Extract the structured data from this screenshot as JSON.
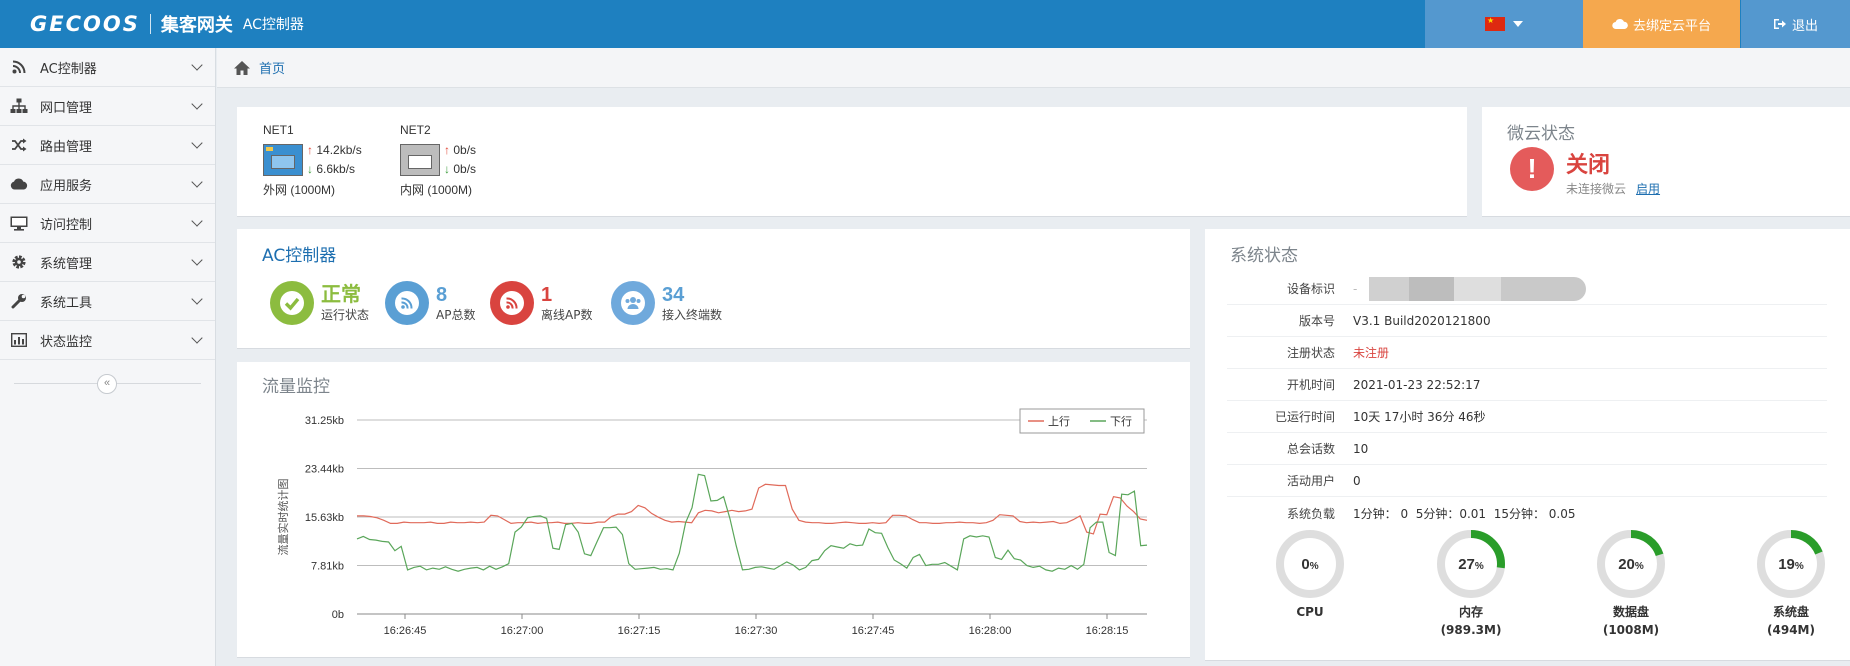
{
  "header": {
    "logo": "GECOOS",
    "brand_name": "集客网关",
    "brand_sub": "AC控制器",
    "cloud_button": "去绑定云平台",
    "logout": "退出"
  },
  "sidebar": {
    "items": [
      {
        "label": "AC控制器",
        "icon": "rss-icon"
      },
      {
        "label": "网口管理",
        "icon": "sitemap-icon"
      },
      {
        "label": "路由管理",
        "icon": "shuffle-icon"
      },
      {
        "label": "应用服务",
        "icon": "cloud-icon"
      },
      {
        "label": "访问控制",
        "icon": "monitor-icon"
      },
      {
        "label": "系统管理",
        "icon": "gear-icon"
      },
      {
        "label": "系统工具",
        "icon": "wrench-icon"
      },
      {
        "label": "状态监控",
        "icon": "bar-chart-icon"
      }
    ],
    "collapse": "«"
  },
  "breadcrumb": {
    "home": "首页"
  },
  "network": {
    "ports": [
      {
        "name": "NET1",
        "up": "14.2kb/s",
        "down": "6.6kb/s",
        "label": "外网 (1000M)",
        "active": true
      },
      {
        "name": "NET2",
        "up": "0b/s",
        "down": "0b/s",
        "label": "内网 (1000M)",
        "active": false
      }
    ]
  },
  "cloud_status": {
    "title": "微云状态",
    "state": "关闭",
    "desc": "未连接微云",
    "link": "启用"
  },
  "ac": {
    "title": "AC控制器",
    "stats": [
      {
        "value": "正常",
        "label": "运行状态",
        "color": "#8cbc3f"
      },
      {
        "value": "8",
        "label": "AP总数",
        "color": "#5a9fd4"
      },
      {
        "value": "1",
        "label": "离线AP数",
        "color": "#d9443f"
      },
      {
        "value": "34",
        "label": "接入终端数",
        "color": "#5a9fd4"
      }
    ]
  },
  "traffic": {
    "title": "流量监控"
  },
  "system": {
    "title": "系统状态",
    "rows": [
      {
        "key": "设备标识",
        "value": "-"
      },
      {
        "key": "版本号",
        "value": "V3.1 Build2020121800"
      },
      {
        "key": "注册状态",
        "value": "未注册"
      },
      {
        "key": "开机时间",
        "value": "2021-01-23 22:52:17"
      },
      {
        "key": "已运行时间",
        "value": "10天 17小时 36分 46秒"
      },
      {
        "key": "总会话数",
        "value": "10"
      },
      {
        "key": "活动用户",
        "value": "0"
      },
      {
        "key": "系统负载",
        "value": "1分钟： 0  5分钟：0.01  15分钟： 0.05"
      }
    ],
    "gauges": [
      {
        "value": 0,
        "text": "0",
        "unit": "%",
        "label": "CPU",
        "sub": ""
      },
      {
        "value": 27,
        "text": "27",
        "unit": "%",
        "label": "内存",
        "sub": "(989.3M)"
      },
      {
        "value": 20,
        "text": "20",
        "unit": "%",
        "label": "数据盘",
        "sub": "(1008M)"
      },
      {
        "value": 19,
        "text": "19",
        "unit": "%",
        "label": "系统盘",
        "sub": "(494M)"
      }
    ]
  },
  "chart_data": {
    "type": "line",
    "title": "",
    "ylabel": "流量实时统计图",
    "y_ticks": [
      "0b",
      "7.81kb",
      "15.63kb",
      "23.44kb",
      "31.25kb"
    ],
    "ylim": [
      0,
      31.25
    ],
    "x_ticks": [
      "16:26:45",
      "16:27:00",
      "16:27:15",
      "16:27:30",
      "16:27:45",
      "16:28:00",
      "16:28:15"
    ],
    "legend_position": "top-right",
    "grid": true,
    "series": [
      {
        "name": "上行",
        "color": "#e06a5a",
        "values": [
          15.8,
          15.8,
          15.7,
          15.5,
          15.1,
          14.6,
          14.6,
          14.8,
          14.7,
          14.7,
          14.7,
          14.8,
          14.6,
          14.6,
          14.8,
          14.7,
          14.7,
          14.8,
          14.7,
          14.8,
          15.9,
          15.8,
          15.2,
          14.6,
          14.7,
          14.7,
          14.8,
          14.6,
          14.7,
          14.7,
          14.8,
          14.6,
          14.6,
          14.7,
          14.6,
          14.6,
          14.8,
          14.8,
          15.7,
          16.1,
          16.1,
          16.5,
          17.5,
          17.1,
          16.2,
          15.6,
          15.1,
          14.8,
          14.9,
          14.8,
          14.7,
          16.3,
          16.7,
          16.6,
          16.3,
          16.5,
          16.7,
          16.5,
          16.6,
          16.9,
          20.3,
          20.9,
          20.8,
          20.7,
          20.7,
          16.9,
          15.1,
          14.8,
          14.7,
          14.7,
          14.6,
          14.6,
          14.7,
          14.8,
          14.7,
          14.6,
          14.6,
          14.7,
          14.6,
          14.7,
          15.9,
          15.9,
          15.8,
          15.2,
          14.7,
          14.7,
          14.6,
          14.6,
          14.7,
          14.7,
          14.8,
          14.7,
          14.7,
          14.6,
          14.7,
          15.1,
          16.0,
          15.9,
          15.8,
          14.9,
          14.7,
          14.8,
          14.7,
          14.8,
          14.9,
          14.6,
          14.7,
          15.2,
          15.8,
          13.2,
          12.9,
          16.1,
          16.0,
          18.9,
          18.7,
          17.4,
          16.5,
          15.3,
          15.1
        ]
      },
      {
        "name": "下行",
        "color": "#5aa65a",
        "values": [
          12.1,
          12.5,
          12.0,
          11.9,
          11.7,
          11.6,
          10.2,
          10.9,
          7.1,
          7.5,
          7.7,
          7.1,
          7.4,
          7.2,
          7.6,
          7.2,
          6.9,
          7.2,
          7.4,
          7.5,
          7.1,
          7.7,
          7.2,
          7.6,
          8.1,
          13.2,
          14.0,
          15.5,
          15.7,
          15.8,
          15.4,
          10.6,
          10.4,
          14.4,
          14.6,
          13.2,
          9.7,
          9.4,
          11.7,
          13.9,
          13.9,
          14.0,
          12.8,
          8.1,
          7.2,
          7.3,
          7.4,
          7.5,
          7.2,
          7.3,
          7.1,
          9.8,
          14.7,
          17.1,
          22.5,
          22.3,
          18.2,
          18.3,
          18.9,
          15.4,
          11.0,
          7.1,
          7.2,
          7.5,
          7.6,
          7.4,
          7.2,
          7.8,
          8.4,
          7.9,
          7.1,
          7.5,
          8.6,
          8.8,
          10.2,
          11.0,
          10.8,
          10.6,
          11.3,
          11.0,
          11.1,
          13.7,
          13.1,
          13.0,
          10.7,
          8.7,
          8.1,
          7.4,
          9.1,
          9.6,
          7.8,
          8.0,
          8.0,
          8.3,
          7.7,
          7.1,
          12.1,
          12.6,
          12.4,
          12.6,
          12.4,
          9.1,
          8.8,
          10.3,
          8.9,
          8.7,
          7.8,
          7.5,
          7.7,
          7.1,
          6.9,
          7.4,
          7.2,
          7.8,
          7.2,
          8.0,
          13.9,
          14.8,
          14.8,
          9.9,
          9.4,
          19.3,
          19.2,
          19.8,
          11.0,
          11.1
        ]
      }
    ]
  }
}
